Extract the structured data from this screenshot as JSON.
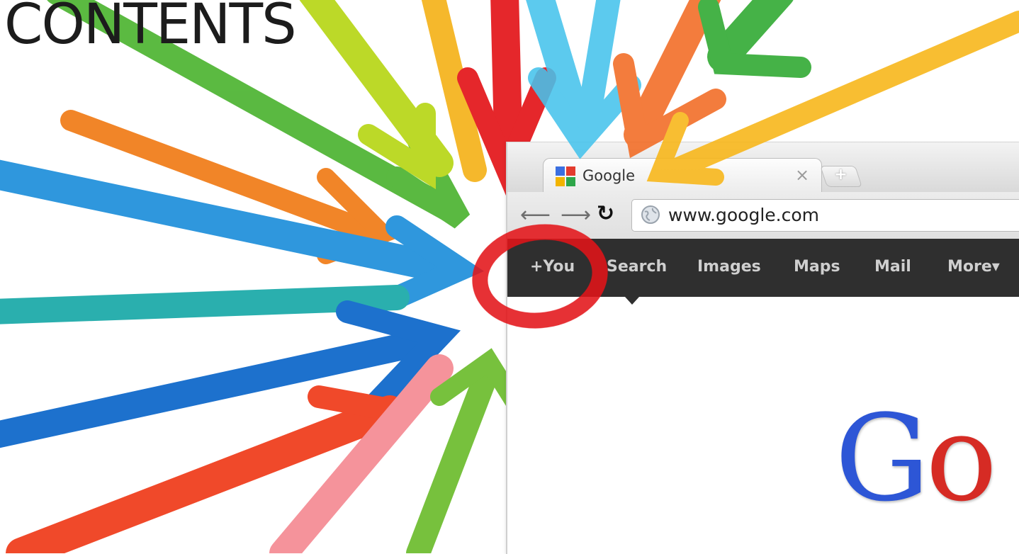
{
  "slide": {
    "title": "CONTENTS"
  },
  "browser": {
    "tab_title": "Google",
    "tab_favicon": "google-plus-icon",
    "close_glyph": "×",
    "new_tab_glyph": "+",
    "back_glyph": "⟵",
    "forward_glyph": "⟶",
    "reload_glyph": "↻",
    "url": "www.google.com",
    "url_icon": "globe-icon"
  },
  "google_bar": {
    "items": [
      {
        "label": "+You"
      },
      {
        "label": "Search"
      },
      {
        "label": "Images"
      },
      {
        "label": "Maps"
      },
      {
        "label": "Mail"
      },
      {
        "label": "More▾"
      }
    ]
  },
  "logo": {
    "letter1": "G",
    "letter2": "o"
  },
  "colors": {
    "google_blue": "#2d56d6",
    "google_red": "#d62b24",
    "bar_bg": "#2f2f2f",
    "paint_red": "#e3151a"
  }
}
